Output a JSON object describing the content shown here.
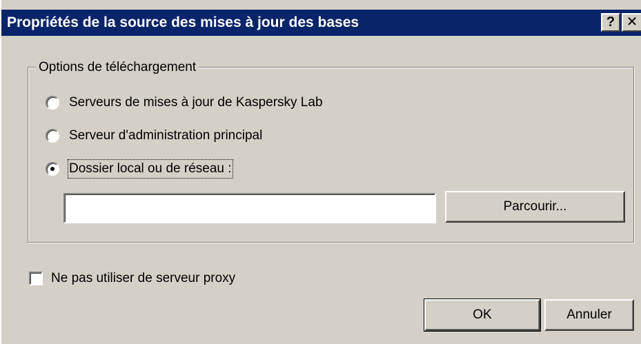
{
  "window": {
    "title": "Propriétés de la source des mises à jour des bases",
    "help_glyph": "?",
    "close_glyph": "✕"
  },
  "download_options": {
    "legend": "Options de téléchargement",
    "radio_options": [
      {
        "label": "Serveurs de mises à jour de Kaspersky Lab",
        "selected": false
      },
      {
        "label": "Serveur d'administration principal",
        "selected": false
      },
      {
        "label": "Dossier local ou de réseau :",
        "selected": true
      }
    ],
    "path_value": "",
    "browse_label": "Parcourir..."
  },
  "proxy": {
    "label": "Ne pas utiliser de serveur proxy",
    "checked": false
  },
  "buttons": {
    "ok_label": "OK",
    "cancel_label": "Annuler"
  }
}
